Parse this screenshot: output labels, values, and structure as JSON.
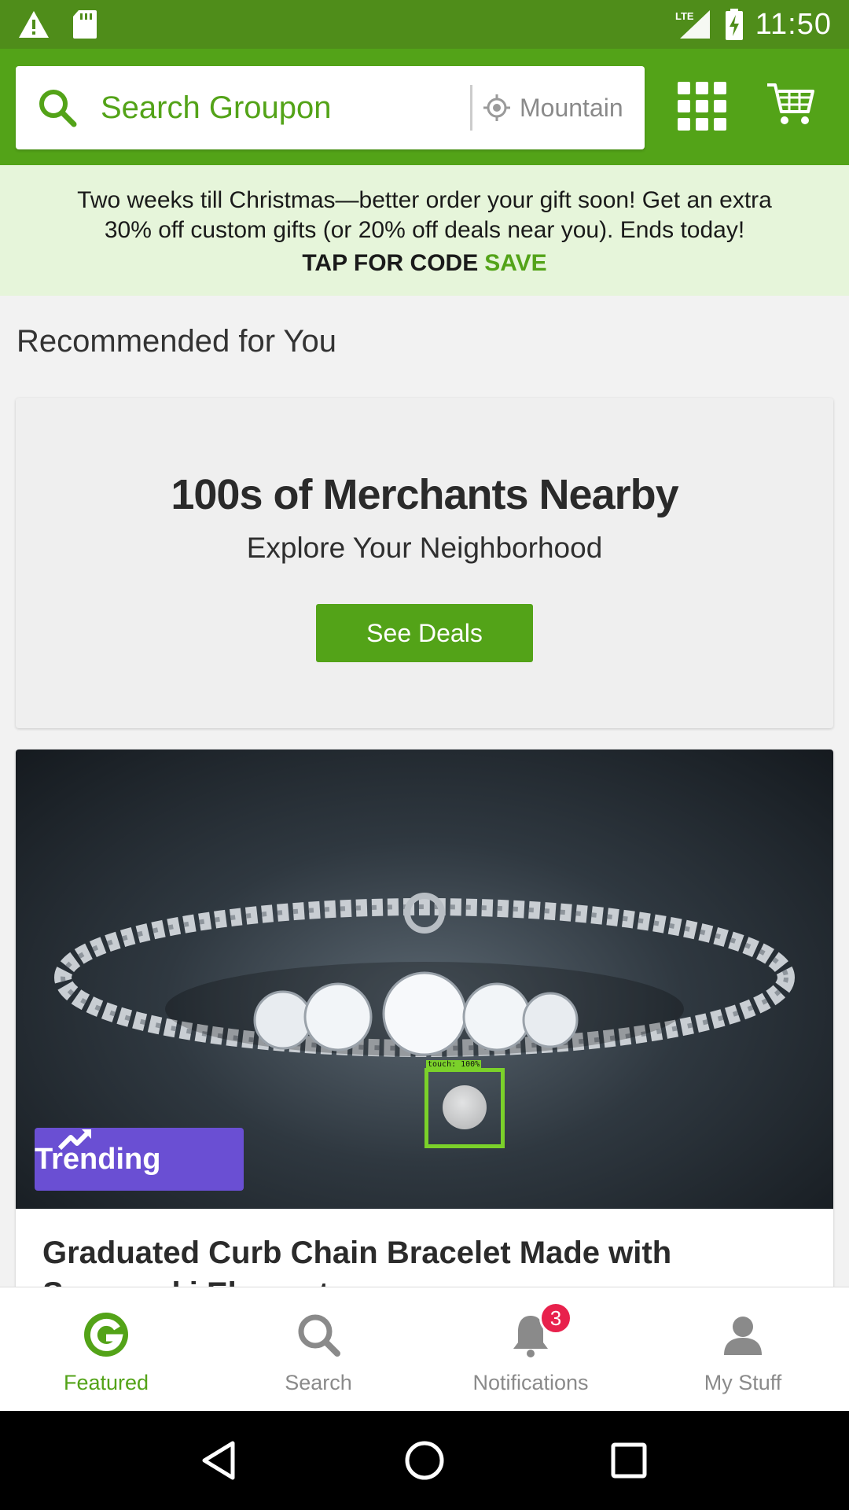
{
  "status_bar": {
    "time": "11:50",
    "network": "LTE",
    "icons": [
      "warning-icon",
      "sd-card-icon",
      "signal-icon",
      "battery-charging-icon"
    ]
  },
  "header": {
    "search_placeholder": "Search Groupon",
    "location": "Mountain View",
    "icons": [
      "search-icon",
      "location-icon",
      "grid-menu-icon",
      "cart-icon"
    ]
  },
  "promo": {
    "line1": "Two weeks till Christmas—better order your gift soon! Get an extra",
    "line2": "30% off custom gifts (or 20% off deals near you). Ends today!",
    "code_label": "TAP FOR CODE",
    "code": "SAVE"
  },
  "recommended": {
    "title": "Recommended for You"
  },
  "merchant_card": {
    "title": "100s of Merchants Nearby",
    "subtitle": "Explore Your Neighborhood",
    "button_label": "See Deals"
  },
  "deal": {
    "badge_label": "Trending",
    "title": "Graduated Curb Chain Bracelet Made with Swarovski Elements"
  },
  "touch_marker": {
    "label": "touch: 100%"
  },
  "bottom_nav": {
    "items": [
      {
        "label": "Featured",
        "icon": "groupon-g-icon",
        "active": true
      },
      {
        "label": "Search",
        "icon": "search-icon",
        "active": false
      },
      {
        "label": "Notifications",
        "icon": "bell-icon",
        "active": false,
        "badge": "3"
      },
      {
        "label": "My Stuff",
        "icon": "person-icon",
        "active": false
      }
    ]
  },
  "colors": {
    "brand_green": "#53a318",
    "status_bar_green": "#4f8d1a",
    "promo_bg": "#e6f5da",
    "trending_purple": "#6a4fd3",
    "badge_red": "#e8214c"
  }
}
